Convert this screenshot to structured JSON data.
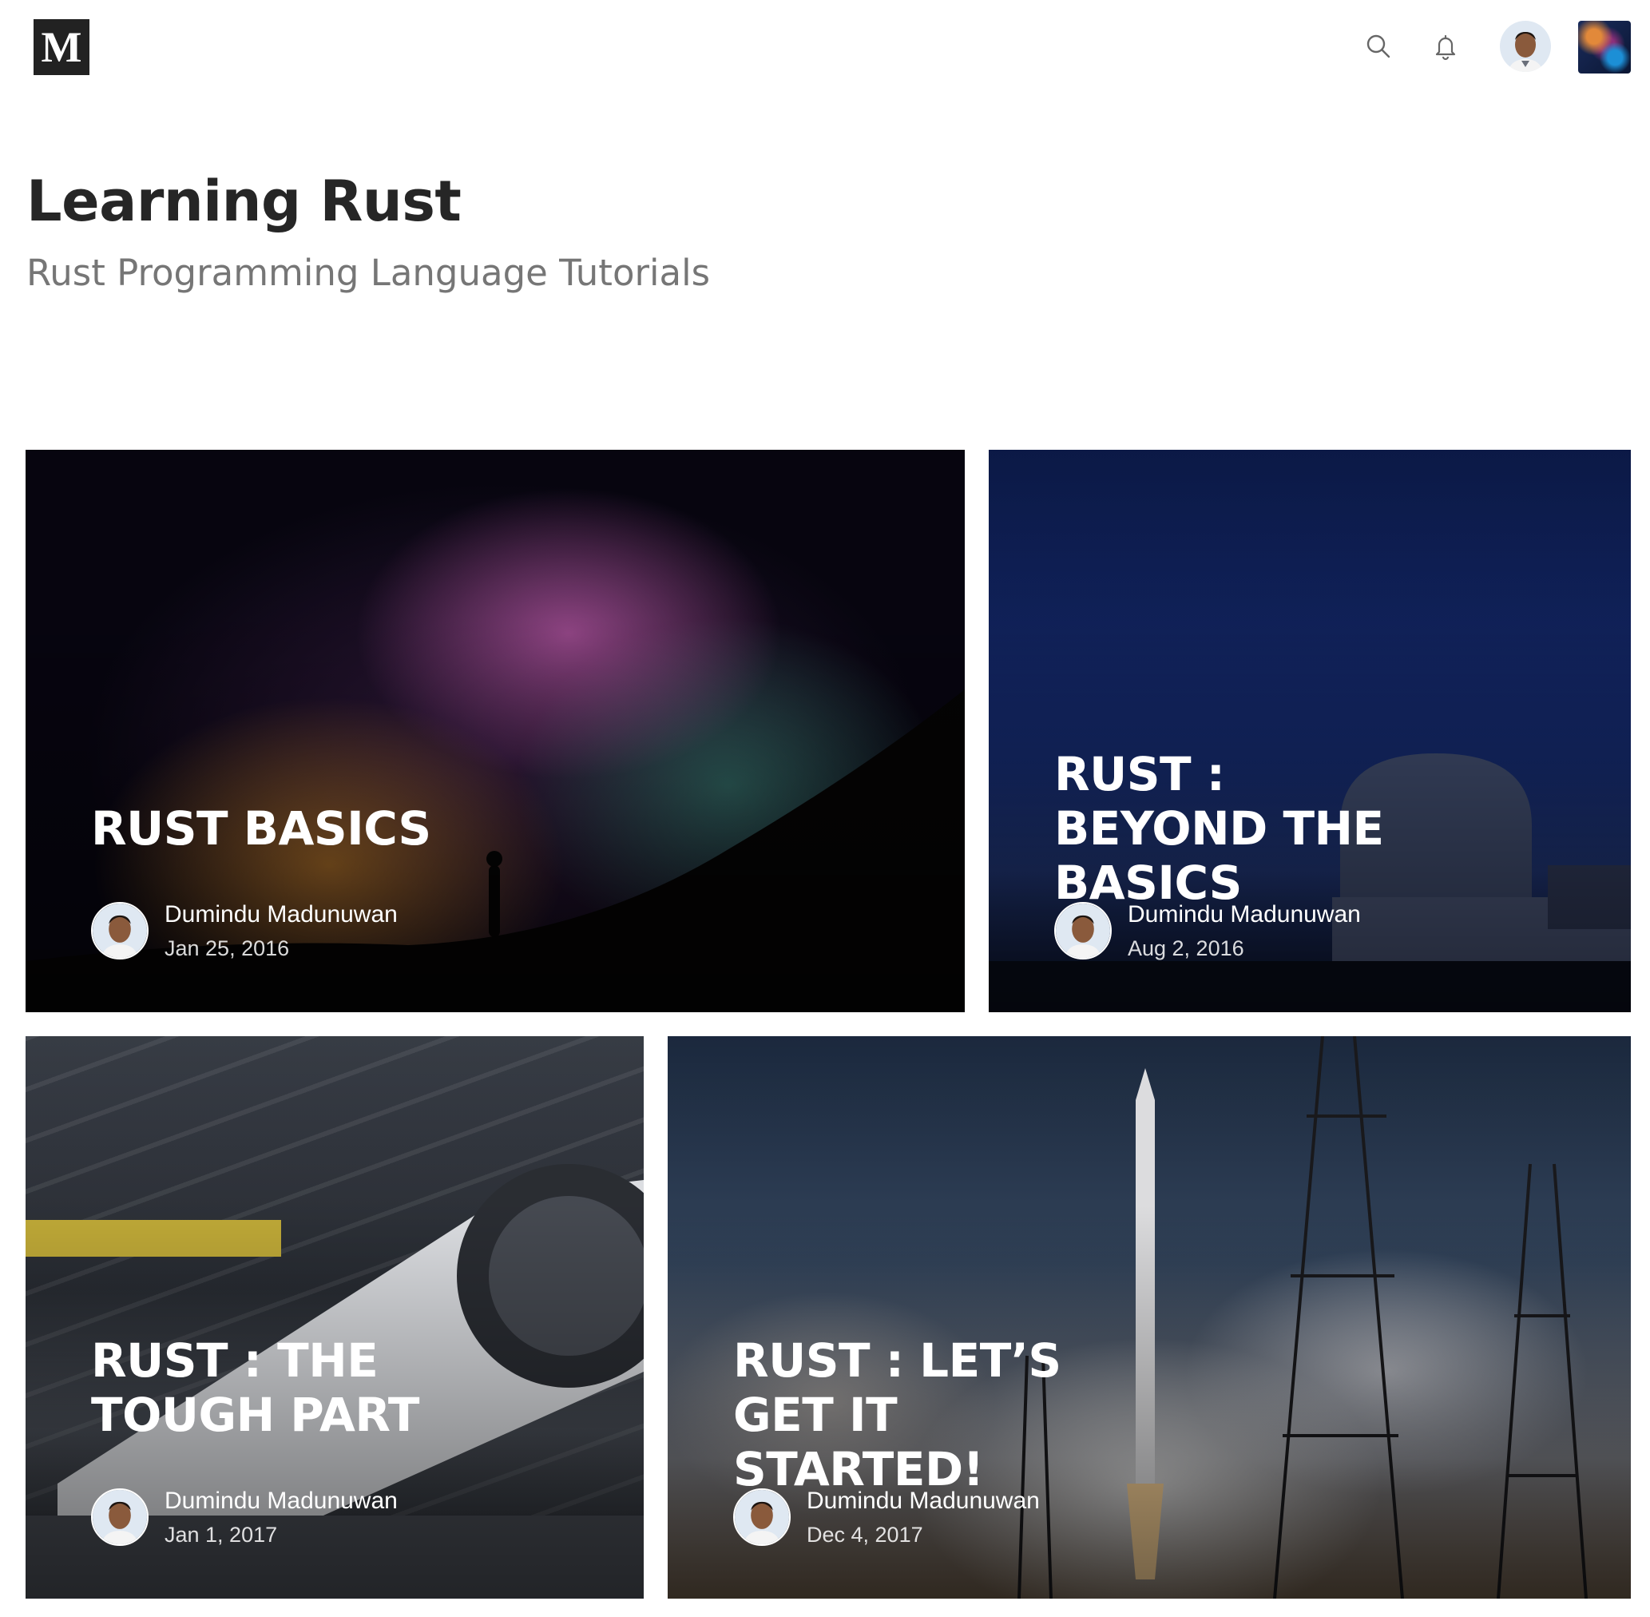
{
  "header": {
    "logo_letter": "M",
    "icons": [
      "search-icon",
      "bell-icon"
    ]
  },
  "publication": {
    "title": "Learning Rust",
    "subtitle": "Rust Programming Language Tutorials"
  },
  "posts": [
    {
      "title": "RUST BASICS",
      "author": "Dumindu Madunuwan",
      "date": "Jan 25, 2016"
    },
    {
      "title": "RUST : BEYOND THE BASICS",
      "author": "Dumindu Madunuwan",
      "date": "Aug 2, 2016"
    },
    {
      "title": "RUST : THE TOUGH PART",
      "author": "Dumindu Madunuwan",
      "date": "Jan 1, 2017"
    },
    {
      "title": "RUST : LET’S GET IT STARTED!",
      "author": "Dumindu Madunuwan",
      "date": "Dec 4, 2017"
    }
  ]
}
